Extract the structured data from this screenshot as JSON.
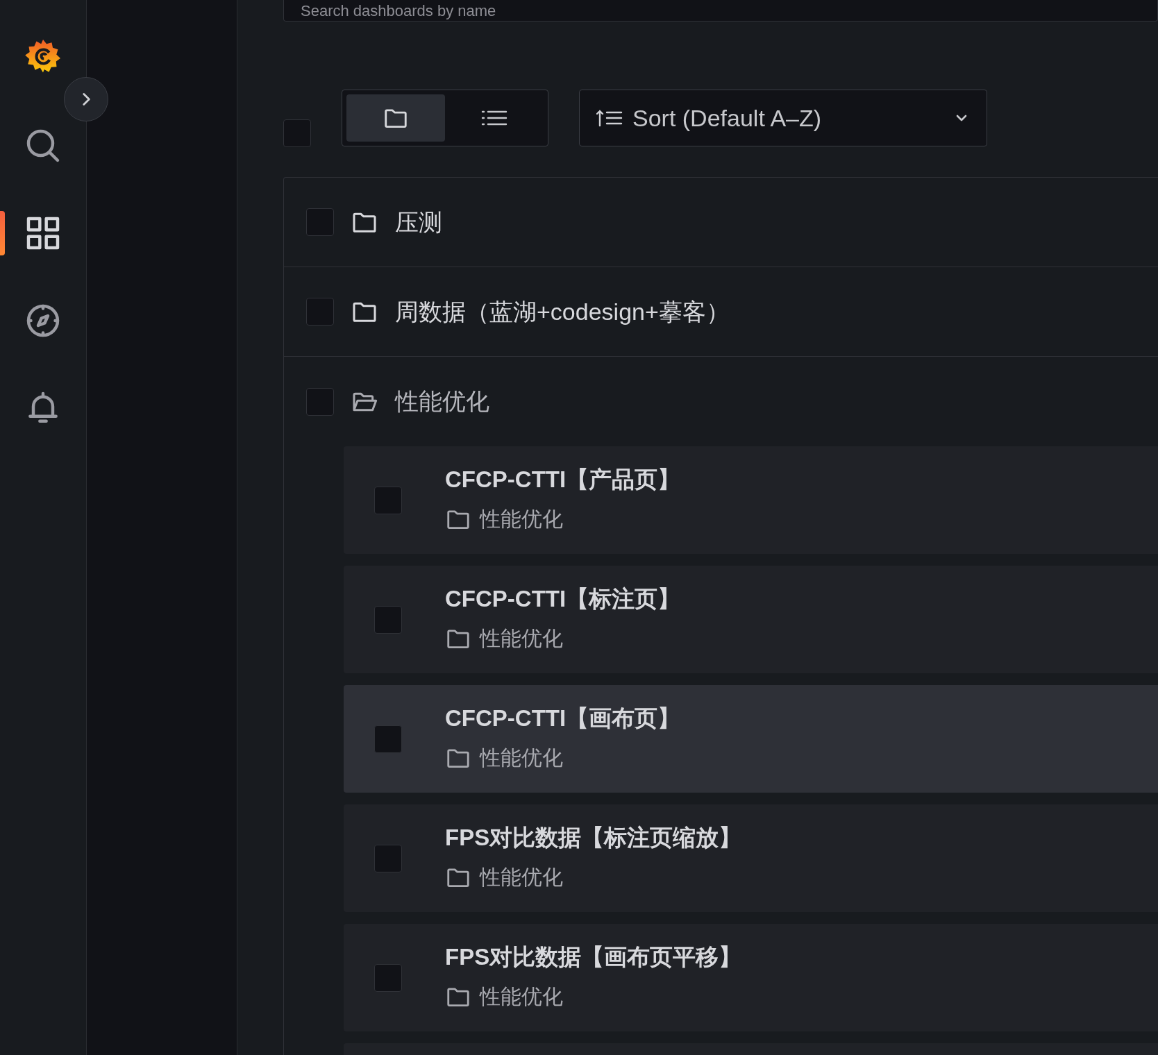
{
  "search": {
    "placeholder": "Search dashboards by name"
  },
  "nav": [
    {
      "selected": false
    },
    {
      "selected": true
    },
    {
      "selected": false
    },
    {
      "selected": false
    }
  ],
  "select_all": {
    "checked": false
  },
  "view_toggle": [
    {
      "selected": true
    },
    {
      "selected": false
    }
  ],
  "sort": {
    "label": "Sort (Default A–Z)"
  },
  "folders": [
    {
      "name": "压测",
      "expanded": false,
      "checked": false
    },
    {
      "name": "周数据（蓝湖+codesign+摹客）",
      "expanded": false,
      "checked": false
    },
    {
      "name": "性能优化",
      "expanded": true,
      "checked": false,
      "dashboards": [
        {
          "title": "CFCP-CTTI【产品页】",
          "folder": "性能优化",
          "checked": false,
          "highlighted": false
        },
        {
          "title": "CFCP-CTTI【标注页】",
          "folder": "性能优化",
          "checked": false,
          "highlighted": false
        },
        {
          "title": "CFCP-CTTI【画布页】",
          "folder": "性能优化",
          "checked": false,
          "highlighted": true
        },
        {
          "title": "FPS对比数据【标注页缩放】",
          "folder": "性能优化",
          "checked": false,
          "highlighted": false
        },
        {
          "title": "FPS对比数据【画布页平移】",
          "folder": "性能优化",
          "checked": false,
          "highlighted": false
        }
      ]
    }
  ]
}
